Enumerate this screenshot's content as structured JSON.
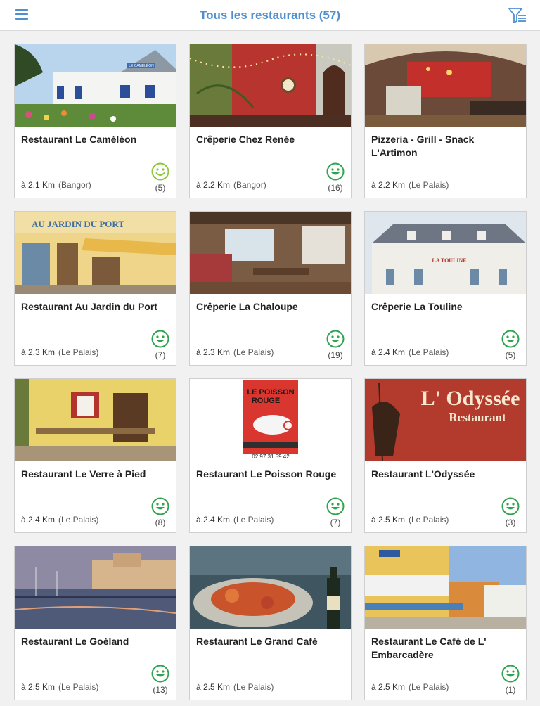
{
  "header": {
    "title": "Tous les restaurants (57)",
    "menu_icon": "hamburger-icon",
    "filter_icon": "filter-icon"
  },
  "colors": {
    "accent": "#4f8fd0",
    "smiley_dark": "#2fa34d",
    "smiley_light": "#8ec63f"
  },
  "restaurants": [
    {
      "name": "Restaurant Le Caméléon",
      "distance": "à 2.1 Km",
      "city": "(Bangor)",
      "count": "(5)",
      "rating": "light"
    },
    {
      "name": "Crêperie Chez Renée",
      "distance": "à 2.2 Km",
      "city": "(Bangor)",
      "count": "(16)",
      "rating": "dark"
    },
    {
      "name": "Pizzeria - Grill - Snack L'Artimon",
      "distance": "à 2.2 Km",
      "city": "(Le Palais)",
      "count": "",
      "rating": "none"
    },
    {
      "name": "Restaurant Au Jardin du Port",
      "distance": "à 2.3 Km",
      "city": "(Le Palais)",
      "count": "(7)",
      "rating": "dark"
    },
    {
      "name": "Crêperie La Chaloupe",
      "distance": "à 2.3 Km",
      "city": "(Le Palais)",
      "count": "(19)",
      "rating": "dark"
    },
    {
      "name": "Crêperie La Touline",
      "distance": "à 2.4 Km",
      "city": "(Le Palais)",
      "count": "(5)",
      "rating": "dark"
    },
    {
      "name": "Restaurant Le Verre à Pied",
      "distance": "à 2.4 Km",
      "city": "(Le Palais)",
      "count": "(8)",
      "rating": "dark"
    },
    {
      "name": "Restaurant Le Poisson Rouge",
      "distance": "à 2.4 Km",
      "city": "(Le Palais)",
      "count": "(7)",
      "rating": "dark"
    },
    {
      "name": "Restaurant L'Odyssée",
      "distance": "à 2.5 Km",
      "city": "(Le Palais)",
      "count": "(3)",
      "rating": "dark"
    },
    {
      "name": "Restaurant Le Goéland",
      "distance": "à 2.5 Km",
      "city": "(Le Palais)",
      "count": "(13)",
      "rating": "dark"
    },
    {
      "name": "Restaurant Le Grand Café",
      "distance": "à 2.5 Km",
      "city": "(Le Palais)",
      "count": "",
      "rating": "none"
    },
    {
      "name": "Restaurant Le Café de L' Embarcadère",
      "distance": "à 2.5 Km",
      "city": "(Le Palais)",
      "count": "(1)",
      "rating": "dark"
    }
  ],
  "photo_texts": {
    "cameleon_sign": "LE CAMÉLÉON",
    "jardin_sign": "AU JARDIN DU PORT",
    "touline_sign": "LA TOULINE",
    "poisson_line1": "LE POISSON",
    "poisson_line2": "ROUGE",
    "poisson_phone": "02 97 31 59 42",
    "odyssee_line1": "L' Odyssée",
    "odyssee_line2": "Restaurant"
  }
}
